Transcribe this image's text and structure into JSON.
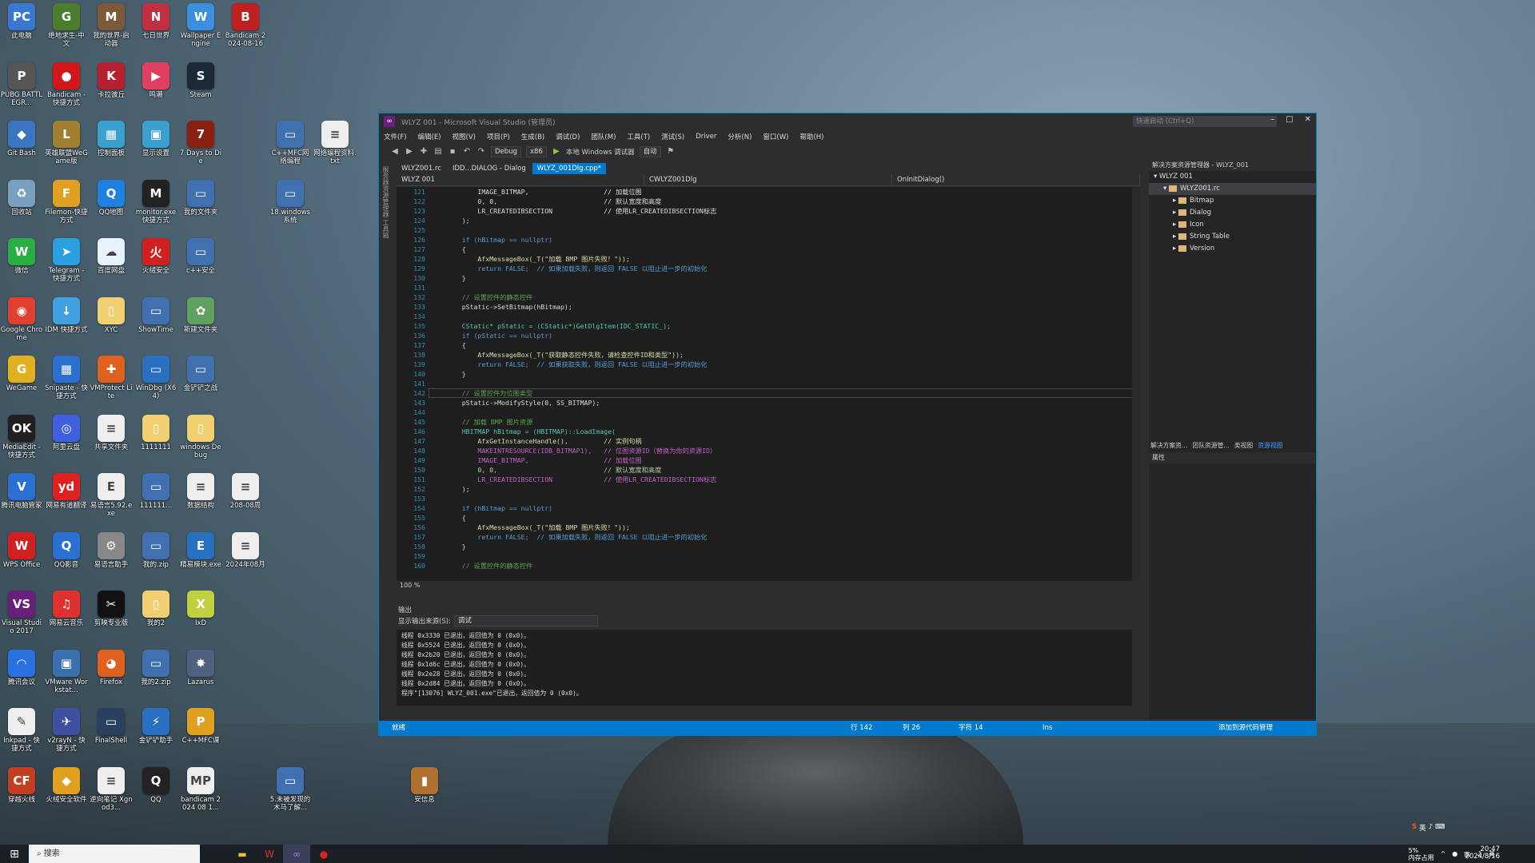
{
  "desktop_icons": [
    {
      "label": "此电脑",
      "color": "#3a78d0",
      "glyph": "PC",
      "col": 0,
      "row": 0
    },
    {
      "label": "绝地求生-中文",
      "color": "#4c7d2f",
      "glyph": "G",
      "col": 1,
      "row": 0
    },
    {
      "label": "我的世界-启动器",
      "color": "#7a5a3a",
      "glyph": "M",
      "col": 2,
      "row": 0
    },
    {
      "label": "七日世界",
      "color": "#c03040",
      "glyph": "N",
      "col": 3,
      "row": 0
    },
    {
      "label": "Wallpaper Engine",
      "color": "#3c8ede",
      "glyph": "W",
      "col": 4,
      "row": 0
    },
    {
      "label": "Bandicam 2024-08-16",
      "color": "#c02020",
      "glyph": "B",
      "col": 5,
      "row": 0
    },
    {
      "label": "PUBG BATTLEGR...",
      "color": "#555",
      "glyph": "P",
      "col": 0,
      "row": 1
    },
    {
      "label": "Bandicam - 快捷方式",
      "color": "#d01818",
      "glyph": "●",
      "col": 1,
      "row": 1
    },
    {
      "label": "卡拉彼丘",
      "color": "#b42030",
      "glyph": "K",
      "col": 2,
      "row": 1
    },
    {
      "label": "鸣潮",
      "color": "#e04060",
      "glyph": "▶",
      "col": 3,
      "row": 1
    },
    {
      "label": "Steam",
      "color": "#1b2838",
      "glyph": "S",
      "col": 4,
      "row": 1
    },
    {
      "label": "Git Bash",
      "color": "#3a76c0",
      "glyph": "◆",
      "col": 0,
      "row": 2
    },
    {
      "label": "英雄联盟WeGame版",
      "color": "#a08030",
      "glyph": "L",
      "col": 1,
      "row": 2
    },
    {
      "label": "控制面板",
      "color": "#3aa0d0",
      "glyph": "▦",
      "col": 2,
      "row": 2
    },
    {
      "label": "显示设置",
      "color": "#3aa0d0",
      "glyph": "▣",
      "col": 3,
      "row": 2
    },
    {
      "label": "7 Days to Die",
      "color": "#8a2010",
      "glyph": "7",
      "col": 4,
      "row": 2
    },
    {
      "label": "C++MFC网络编程",
      "color": "#4070b0",
      "glyph": "▭",
      "col": 6,
      "row": 2
    },
    {
      "label": "网络编程资料.txt",
      "color": "#eeeeee",
      "glyph": "≡",
      "col": 7,
      "row": 2
    },
    {
      "label": "回收站",
      "color": "#7aa0c0",
      "glyph": "♻",
      "col": 0,
      "row": 3
    },
    {
      "label": "Filemon-快捷方式",
      "color": "#e0a020",
      "glyph": "F",
      "col": 1,
      "row": 3
    },
    {
      "label": "QQ地图",
      "color": "#2080e0",
      "glyph": "Q",
      "col": 2,
      "row": 3
    },
    {
      "label": "monitor.exe 快捷方式",
      "color": "#222",
      "glyph": "M",
      "col": 3,
      "row": 3
    },
    {
      "label": "我的文件夹",
      "color": "#4070b0",
      "glyph": "▭",
      "col": 4,
      "row": 3
    },
    {
      "label": "18.windows系统",
      "color": "#4070b0",
      "glyph": "▭",
      "col": 6,
      "row": 3
    },
    {
      "label": "微信",
      "color": "#2aae43",
      "glyph": "W",
      "col": 0,
      "row": 4
    },
    {
      "label": "Telegram - 快捷方式",
      "color": "#2aa0e0",
      "glyph": "➤",
      "col": 1,
      "row": 4
    },
    {
      "label": "百度网盘",
      "color": "#e8f2ff",
      "glyph": "☁",
      "col": 2,
      "row": 4
    },
    {
      "label": "火绒安全",
      "color": "#d02020",
      "glyph": "火",
      "col": 3,
      "row": 4
    },
    {
      "label": "c++安全",
      "color": "#4070b0",
      "glyph": "▭",
      "col": 4,
      "row": 4
    },
    {
      "label": "Google Chrome",
      "color": "#e04030",
      "glyph": "◉",
      "col": 0,
      "row": 5
    },
    {
      "label": "IDM 快捷方式",
      "color": "#40a0e0",
      "glyph": "↓",
      "col": 1,
      "row": 5
    },
    {
      "label": "XYC",
      "color": "#f0d070",
      "glyph": "▯",
      "col": 2,
      "row": 5
    },
    {
      "label": "ShowTime",
      "color": "#4070b0",
      "glyph": "▭",
      "col": 3,
      "row": 5
    },
    {
      "label": "新建文件夹",
      "color": "#60a060",
      "glyph": "✿",
      "col": 4,
      "row": 5
    },
    {
      "label": "WeGame",
      "color": "#e0b020",
      "glyph": "G",
      "col": 0,
      "row": 6
    },
    {
      "label": "Snipaste - 快捷方式",
      "color": "#2a70d0",
      "glyph": "▦",
      "col": 1,
      "row": 6
    },
    {
      "label": "VMProtect Lite",
      "color": "#e06020",
      "glyph": "✚",
      "col": 2,
      "row": 6
    },
    {
      "label": "WinDbg (X64)",
      "color": "#2a70c0",
      "glyph": "▭",
      "col": 3,
      "row": 6
    },
    {
      "label": "金铲铲之战",
      "color": "#4070b0",
      "glyph": "▭",
      "col": 4,
      "row": 6
    },
    {
      "label": "MediaEdit - 快捷方式",
      "color": "#202020",
      "glyph": "OK",
      "col": 0,
      "row": 7
    },
    {
      "label": "阿里云盘",
      "color": "#4060e0",
      "glyph": "◎",
      "col": 1,
      "row": 7
    },
    {
      "label": "共享文件夹",
      "color": "#eeeeee",
      "glyph": "≡",
      "col": 2,
      "row": 7
    },
    {
      "label": "1111111",
      "color": "#f0d070",
      "glyph": "▯",
      "col": 3,
      "row": 7
    },
    {
      "label": "windows Debug",
      "color": "#f0d070",
      "glyph": "▯",
      "col": 4,
      "row": 7
    },
    {
      "label": "腾讯电脑管家",
      "color": "#2a70d0",
      "glyph": "V",
      "col": 0,
      "row": 8
    },
    {
      "label": "网易有道翻译",
      "color": "#e02020",
      "glyph": "yd",
      "col": 1,
      "row": 8
    },
    {
      "label": "易语言5.92.exe",
      "color": "#eeeeee",
      "glyph": "E",
      "col": 2,
      "row": 8
    },
    {
      "label": "111111...",
      "color": "#4070b0",
      "glyph": "▭",
      "col": 3,
      "row": 8
    },
    {
      "label": "数据结构",
      "color": "#eeeeee",
      "glyph": "≡",
      "col": 4,
      "row": 8
    },
    {
      "label": "208-08周",
      "color": "#eeeeee",
      "glyph": "≡",
      "col": 5,
      "row": 8
    },
    {
      "label": "WPS Office",
      "color": "#d02020",
      "glyph": "W",
      "col": 0,
      "row": 9
    },
    {
      "label": "QQ影音",
      "color": "#2a70d0",
      "glyph": "Q",
      "col": 1,
      "row": 9
    },
    {
      "label": "易语言助手",
      "color": "#888",
      "glyph": "⚙",
      "col": 2,
      "row": 9
    },
    {
      "label": "我的.zip",
      "color": "#4070b0",
      "glyph": "▭",
      "col": 3,
      "row": 9
    },
    {
      "label": "精易模块.exe",
      "color": "#2a70c0",
      "glyph": "E",
      "col": 4,
      "row": 9
    },
    {
      "label": "2024年08月",
      "color": "#eeeeee",
      "glyph": "≡",
      "col": 5,
      "row": 9
    },
    {
      "label": "Visual Studio 2017",
      "color": "#68217a",
      "glyph": "VS",
      "col": 0,
      "row": 10
    },
    {
      "label": "网易云音乐",
      "color": "#e03030",
      "glyph": "♫",
      "col": 1,
      "row": 10
    },
    {
      "label": "剪映专业版",
      "color": "#111",
      "glyph": "✂",
      "col": 2,
      "row": 10
    },
    {
      "label": "我的2",
      "color": "#f0d070",
      "glyph": "▯",
      "col": 3,
      "row": 10
    },
    {
      "label": "IxD",
      "color": "#c0d040",
      "glyph": "X",
      "col": 4,
      "row": 10
    },
    {
      "label": "腾讯会议",
      "color": "#2a70e0",
      "glyph": "◠",
      "col": 0,
      "row": 11
    },
    {
      "label": "VMware Workstat...",
      "color": "#3a70b0",
      "glyph": "▣",
      "col": 1,
      "row": 11
    },
    {
      "label": "Firefox",
      "color": "#e06020",
      "glyph": "◕",
      "col": 2,
      "row": 11
    },
    {
      "label": "我的2.zip",
      "color": "#4070b0",
      "glyph": "▭",
      "col": 3,
      "row": 11
    },
    {
      "label": "Lazarus",
      "color": "#506080",
      "glyph": "✸",
      "col": 4,
      "row": 11
    },
    {
      "label": "Inkpad - 快捷方式",
      "color": "#eeeeee",
      "glyph": "✎",
      "col": 0,
      "row": 12
    },
    {
      "label": "v2rayN - 快捷方式",
      "color": "#4050a0",
      "glyph": "✈",
      "col": 1,
      "row": 12
    },
    {
      "label": "FinalShell",
      "color": "#2a4060",
      "glyph": "▭",
      "col": 2,
      "row": 12
    },
    {
      "label": "金铲铲助手",
      "color": "#2a70c0",
      "glyph": "⚡",
      "col": 3,
      "row": 12
    },
    {
      "label": "C++MFC课",
      "color": "#e0a020",
      "glyph": "P",
      "col": 4,
      "row": 12
    },
    {
      "label": "穿越火线",
      "color": "#c04020",
      "glyph": "CF",
      "col": 0,
      "row": 13
    },
    {
      "label": "火绒安全软件",
      "color": "#e0a020",
      "glyph": "◆",
      "col": 1,
      "row": 13
    },
    {
      "label": "逆向笔记 Xgnod3...",
      "color": "#eeeeee",
      "glyph": "≡",
      "col": 2,
      "row": 13
    },
    {
      "label": "QQ",
      "color": "#222",
      "glyph": "Q",
      "col": 3,
      "row": 13
    },
    {
      "label": "bandicam 2024 08 1...",
      "color": "#eeeeee",
      "glyph": "MP",
      "col": 4,
      "row": 13
    },
    {
      "label": "5.未被发现的木马了解...",
      "color": "#4070b0",
      "glyph": "▭",
      "col": 6,
      "row": 13
    },
    {
      "label": "安信息",
      "color": "#b07030",
      "glyph": "▮",
      "col": 9,
      "row": 13
    }
  ],
  "vs": {
    "title": "WLYZ 001 - Microsoft Visual Studio (管理员)",
    "quick_launch": "快速启动 (Ctrl+Q)",
    "compare": "同比较",
    "menu": [
      "文件(F)",
      "编辑(E)",
      "视图(V)",
      "项目(P)",
      "生成(B)",
      "调试(D)",
      "团队(M)",
      "工具(T)",
      "测试(S)",
      "Driver",
      "分析(N)",
      "窗口(W)",
      "帮助(H)"
    ],
    "toolbar": {
      "config": "Debug",
      "platform": "x86",
      "run": "本地 Windows 调试器",
      "mode": "自动"
    },
    "left_strip": "服务器资源管理器 工具箱",
    "tabs": [
      "WLYZ001.rc",
      "IDD...DIALOG - Dialog",
      "WLYZ_001Dlg.cpp*"
    ],
    "nav": {
      "project": "WLYZ 001",
      "class": "CWLYZ001Dlg",
      "member": "OnInitDialog()"
    },
    "zoom": "100 %",
    "line_numbers": [
      "121",
      "122",
      "123",
      "124",
      "125",
      "126",
      "127",
      "128",
      "129",
      "130",
      "131",
      "132",
      "133",
      "134",
      "135",
      "136",
      "137",
      "138",
      "139",
      "140",
      "141",
      "142",
      "143",
      "144",
      "145",
      "146",
      "147",
      "148",
      "149",
      "150",
      "151",
      "152",
      "153",
      "154",
      "155",
      "156",
      "157",
      "158",
      "159",
      "160"
    ],
    "code": [
      {
        "t": "        IMAGE_BITMAP,                   // 加载位图",
        "c": "tx"
      },
      {
        "t": "        0, 0,                           // 默认宽度和高度",
        "c": "tx"
      },
      {
        "t": "        LR_CREATEDIBSECTION             // 使用LR_CREATEDIBSECTION标志",
        "c": "tx"
      },
      {
        "t": "    );",
        "c": "tx"
      },
      {
        "t": "",
        "c": "tx"
      },
      {
        "t": "    if (hBitmap == nullptr)",
        "c": "kw"
      },
      {
        "t": "    {",
        "c": "tx"
      },
      {
        "t": "        AfxMessageBox(_T(\"加载 BMP 图片失败！\"));",
        "c": "fn"
      },
      {
        "t": "        return FALSE;  // 如果加载失败，则返回 FALSE 以阻止进一步的初始化",
        "c": "kw"
      },
      {
        "t": "    }",
        "c": "tx"
      },
      {
        "t": "",
        "c": "tx"
      },
      {
        "t": "    // 设置控件的静态控件",
        "c": "cm"
      },
      {
        "t": "    pStatic->SetBitmap(hBitmap);",
        "c": "tx"
      },
      {
        "t": "",
        "c": "tx"
      },
      {
        "t": "    CStatic* pStatic = (CStatic*)GetDlgItem(IDC_STATIC_);",
        "c": "ty"
      },
      {
        "t": "    if (pStatic == nullptr)",
        "c": "kw"
      },
      {
        "t": "    {",
        "c": "tx"
      },
      {
        "t": "        AfxMessageBox(_T(\"获取静态控件失败，请检查控件ID和类型\"));",
        "c": "fn"
      },
      {
        "t": "        return FALSE;  // 如果获取失败，则返回 FALSE 以阻止进一步的初始化",
        "c": "kw"
      },
      {
        "t": "    }",
        "c": "tx"
      },
      {
        "t": "",
        "c": "tx"
      },
      {
        "t": "    // 设置控件为位图类型",
        "c": "cm"
      },
      {
        "t": "    pStatic->ModifyStyle(0, SS_BITMAP);",
        "c": "tx"
      },
      {
        "t": "",
        "c": "tx"
      },
      {
        "t": "    // 加载 BMP 图片资源",
        "c": "cm"
      },
      {
        "t": "    HBITMAP hBitmap = (HBITMAP)::LoadImage(",
        "c": "ty"
      },
      {
        "t": "        AfxGetInstanceHandle(),         // 实例句柄",
        "c": "fn"
      },
      {
        "t": "        MAKEINTRESOURCE(IDB_BITMAP1),   // 位图资源ID（替换为你的资源ID）",
        "c": "mc"
      },
      {
        "t": "        IMAGE_BITMAP,                   // 加载位图",
        "c": "mc"
      },
      {
        "t": "        0, 0,                           // 默认宽度和高度",
        "c": "nm"
      },
      {
        "t": "        LR_CREATEDIBSECTION             // 使用LR_CREATEDIBSECTION标志",
        "c": "mc"
      },
      {
        "t": "    );",
        "c": "tx"
      },
      {
        "t": "",
        "c": "tx"
      },
      {
        "t": "    if (hBitmap == nullptr)",
        "c": "kw"
      },
      {
        "t": "    {",
        "c": "tx"
      },
      {
        "t": "        AfxMessageBox(_T(\"加载 BMP 图片失败！\"));",
        "c": "fn"
      },
      {
        "t": "        return FALSE;  // 如果加载失败，则返回 FALSE 以阻止进一步的初始化",
        "c": "kw"
      },
      {
        "t": "    }",
        "c": "tx"
      },
      {
        "t": "",
        "c": "tx"
      },
      {
        "t": "    // 设置控件的静态控件",
        "c": "cm"
      }
    ],
    "current_line_index": 21,
    "output": {
      "title": "输出",
      "source_label": "显示输出来源(S):",
      "source_value": "调试",
      "lines": [
        "线程 0x3330 已退出，返回值为 0 (0x0)。",
        "线程 0x5524 已退出，返回值为 0 (0x0)。",
        "线程 0x2b20 已退出，返回值为 0 (0x0)。",
        "线程 0x1d6c 已退出，返回值为 0 (0x0)。",
        "线程 0x2e28 已退出，返回值为 0 (0x0)。",
        "线程 0x2d84 已退出，返回值为 0 (0x0)。",
        "程序\"[13076] WLYZ_001.exe\"已退出，返回值为 0 (0x0)。"
      ]
    },
    "solution": {
      "title": "解决方案资源管理器 - WLYZ_001",
      "root": "WLYZ 001",
      "rc": "WLYZ001.rc",
      "folders": [
        "Bitmap",
        "Dialog",
        "Icon",
        "String Table",
        "Version"
      ]
    },
    "right_tabs": [
      "解决方案资...",
      "团队资源管...",
      "类视图",
      "资源视图"
    ],
    "properties_title": "属性",
    "status": {
      "ready": "就绪",
      "line": "行 142",
      "col": "列 26",
      "char": "字符 14",
      "ins": "Ins",
      "source_control": "添加到源代码管理"
    }
  },
  "taskbar": {
    "search": "搜索",
    "tray_text": "5%\n内存占用",
    "time": "20:47",
    "date": "2024/8/16",
    "ime": "英"
  }
}
